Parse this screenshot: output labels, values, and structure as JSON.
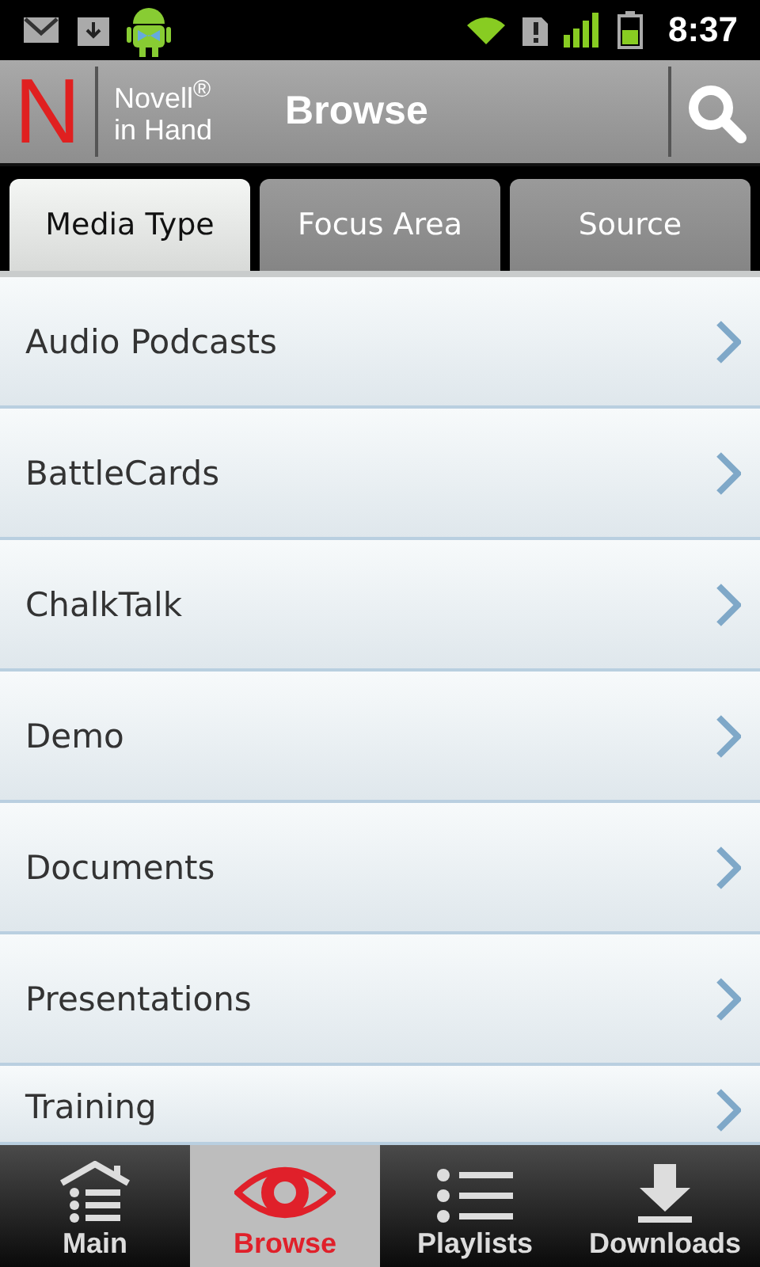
{
  "status_bar": {
    "time": "8:37"
  },
  "header": {
    "logo": "N",
    "brand": "Novell$^{®}$",
    "brand_line2": "in Hand",
    "title": "Browse"
  },
  "tabs": [
    {
      "label": "Media Type",
      "selected": true
    },
    {
      "label": "Focus Area",
      "selected": false
    },
    {
      "label": "Source",
      "selected": false
    }
  ],
  "list": {
    "items": [
      {
        "label": "Audio Podcasts"
      },
      {
        "label": "BattleCards"
      },
      {
        "label": "ChalkTalk"
      },
      {
        "label": "Demo"
      },
      {
        "label": "Documents"
      },
      {
        "label": "Presentations"
      },
      {
        "label": "Training"
      }
    ]
  },
  "bottom_nav": [
    {
      "label": "Main",
      "kind": "home",
      "selected": false
    },
    {
      "label": "Browse",
      "kind": "eye",
      "selected": true
    },
    {
      "label": "Playlists",
      "kind": "list",
      "selected": false
    },
    {
      "label": "Downloads",
      "kind": "download",
      "selected": false
    }
  ]
}
